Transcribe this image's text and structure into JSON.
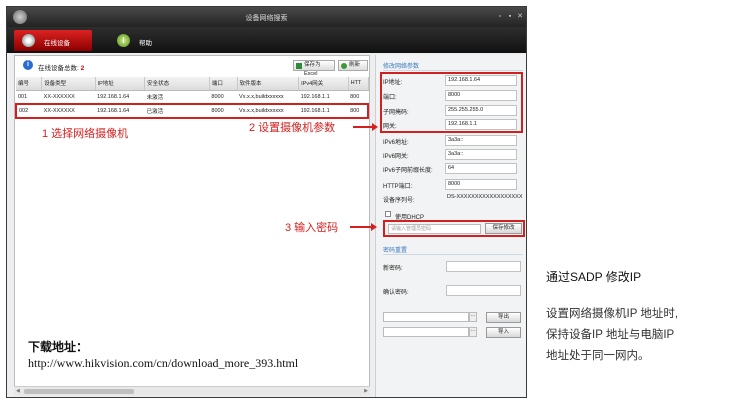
{
  "window": {
    "title": "设备网络搜索",
    "controls": [
      "▫",
      "▪",
      "✕"
    ]
  },
  "tabs": [
    {
      "label": "在线设备",
      "icon": "device-icon",
      "active": true
    },
    {
      "label": "帮助",
      "icon": "help-icon",
      "icon_glyph": "i",
      "active": false
    }
  ],
  "toolbar": {
    "count_label": "在线设备总数:",
    "count_value": "2",
    "export_excel": "保存为Excel",
    "refresh": "刷新"
  },
  "device_table": {
    "columns": [
      "编号",
      "设备类型",
      "IP地址",
      "安全状态",
      "端口",
      "软件版本",
      "IPv4网关",
      "HTT"
    ],
    "rows": [
      [
        "001",
        "XX-XXXXXX",
        "192.168.1.64",
        "未激活",
        "8000",
        "Vx.x.x,buildxxxxxx",
        "192.168.1.1",
        "800"
      ],
      [
        "002",
        "XX-XXXXXX",
        "192.168.1.64",
        "已激活",
        "8000",
        "Vx.x.x,buildxxxxxx",
        "192.168.1.1",
        "800"
      ]
    ],
    "selected_row": 1
  },
  "annotations": {
    "step1": "1 选择网络摄像机",
    "step2": "2 设置摄像机参数",
    "step3": "3 输入密码"
  },
  "download": {
    "title": "下载地址：",
    "url": "http://www.hikvision.com/cn/download_more_393.html"
  },
  "network_params": {
    "section_title": "修改网络参数",
    "fields": [
      {
        "label": "IP地址:",
        "value": "192.168.1.64"
      },
      {
        "label": "端口:",
        "value": "8000"
      },
      {
        "label": "子网掩码:",
        "value": "255.255.255.0"
      },
      {
        "label": "网关:",
        "value": "192.168.1.1"
      },
      {
        "label": "IPv6地址:",
        "value": "3a3a::"
      },
      {
        "label": "IPv6网关:",
        "value": "3a3a::"
      },
      {
        "label": "IPv6子网前缀长度:",
        "value": "64"
      },
      {
        "label": "HTTP端口:",
        "value": "8000"
      },
      {
        "label": "设备序列号:",
        "value": "DS-XXXXXXXXXXXXXXXXXX"
      }
    ],
    "dhcp_label": "使用DHCP",
    "password_placeholder": "请输入管理员密码",
    "save_button": "保存修改"
  },
  "password_reset": {
    "section_title": "密码重置",
    "new_password_label": "新密码:",
    "confirm_password_label": "确认密码:",
    "export_button": "导出",
    "import_button": "导入",
    "dots": "···"
  },
  "side_panel": {
    "heading": "通过SADP 修改IP",
    "description_lines": [
      "设置网络摄像机IP 地址时,",
      "保持设备IP 地址与电脑IP",
      "地址处于同一网内。"
    ]
  },
  "colors": {
    "accent_red": "#d62020",
    "title_bar": "#2a2a2a",
    "section_blue": "#3a7bbf"
  }
}
